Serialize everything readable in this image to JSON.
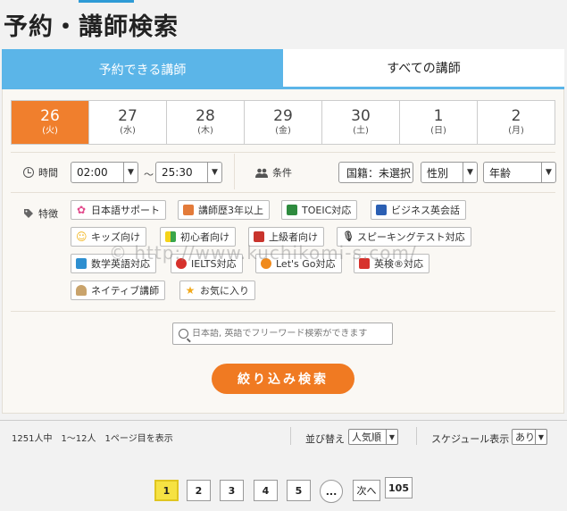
{
  "title": "予約・講師検索",
  "tabs": [
    {
      "label": "予約できる講師",
      "active": true
    },
    {
      "label": "すべての講師",
      "active": false
    }
  ],
  "dates": [
    {
      "day": "26",
      "dow": "(火)",
      "active": true
    },
    {
      "day": "27",
      "dow": "(水)",
      "active": false
    },
    {
      "day": "28",
      "dow": "(木)",
      "active": false
    },
    {
      "day": "29",
      "dow": "(金)",
      "active": false
    },
    {
      "day": "30",
      "dow": "(土)",
      "active": false
    },
    {
      "day": "1",
      "dow": "(日)",
      "active": false
    },
    {
      "day": "2",
      "dow": "(月)",
      "active": false
    }
  ],
  "time": {
    "label": "時間",
    "from": "02:00",
    "separator": "～",
    "to": "25:30"
  },
  "conditions": {
    "label": "条件",
    "nationality": "国籍：未選択",
    "gender": "性別",
    "age": "年齢"
  },
  "features": {
    "label": "特徴",
    "tags": [
      {
        "label": "日本語サポート",
        "icon": "flower-icon",
        "color": "#e24a8c"
      },
      {
        "label": "講師歴3年以上",
        "icon": "box-icon",
        "color": "#e37b3a"
      },
      {
        "label": "TOEIC対応",
        "icon": "flag-icon",
        "color": "#2e8b3e"
      },
      {
        "label": "ビジネス英会話",
        "icon": "books-icon",
        "color": "#2b5fb3"
      },
      {
        "label": "キッズ向け",
        "icon": "smile-icon",
        "color": "#f2b51d"
      },
      {
        "label": "初心者向け",
        "icon": "beginner-icon",
        "color": "#3aa64a"
      },
      {
        "label": "上級者向け",
        "icon": "graduation-cap-icon",
        "color": "#c9342d"
      },
      {
        "label": "スピーキングテスト対応",
        "icon": "microphone-icon",
        "color": "#444444"
      },
      {
        "label": "数学英語対応",
        "icon": "grid-icon",
        "color": "#2e8fd0"
      },
      {
        "label": "IELTS対応",
        "icon": "ielts-icon",
        "color": "#d7322c"
      },
      {
        "label": "Let's Go対応",
        "icon": "letsgo-icon",
        "color": "#f08a1c"
      },
      {
        "label": "英検®対応",
        "icon": "eiken-icon",
        "color": "#d7322c"
      },
      {
        "label": "ネイティブ講師",
        "icon": "person-icon",
        "color": "#c9a36b"
      },
      {
        "label": "お気に入り",
        "icon": "star-icon",
        "color": "#f2a91b"
      }
    ]
  },
  "search": {
    "placeholder": "日本語, 英語でフリーワード検索ができます"
  },
  "filter_button": "絞り込み検索",
  "results": {
    "summary": "1251人中　1～12人　1ページ目を表示",
    "sort_label": "並び替え",
    "sort_value": "人気順",
    "schedule_label": "スケジュール表示",
    "schedule_value": "あり"
  },
  "pager": {
    "pages": [
      "1",
      "2",
      "3",
      "4",
      "5"
    ],
    "ellipsis": "...",
    "next": "次へ",
    "last": "105"
  },
  "watermark": "© http://www.kuchikomi-s.com/"
}
